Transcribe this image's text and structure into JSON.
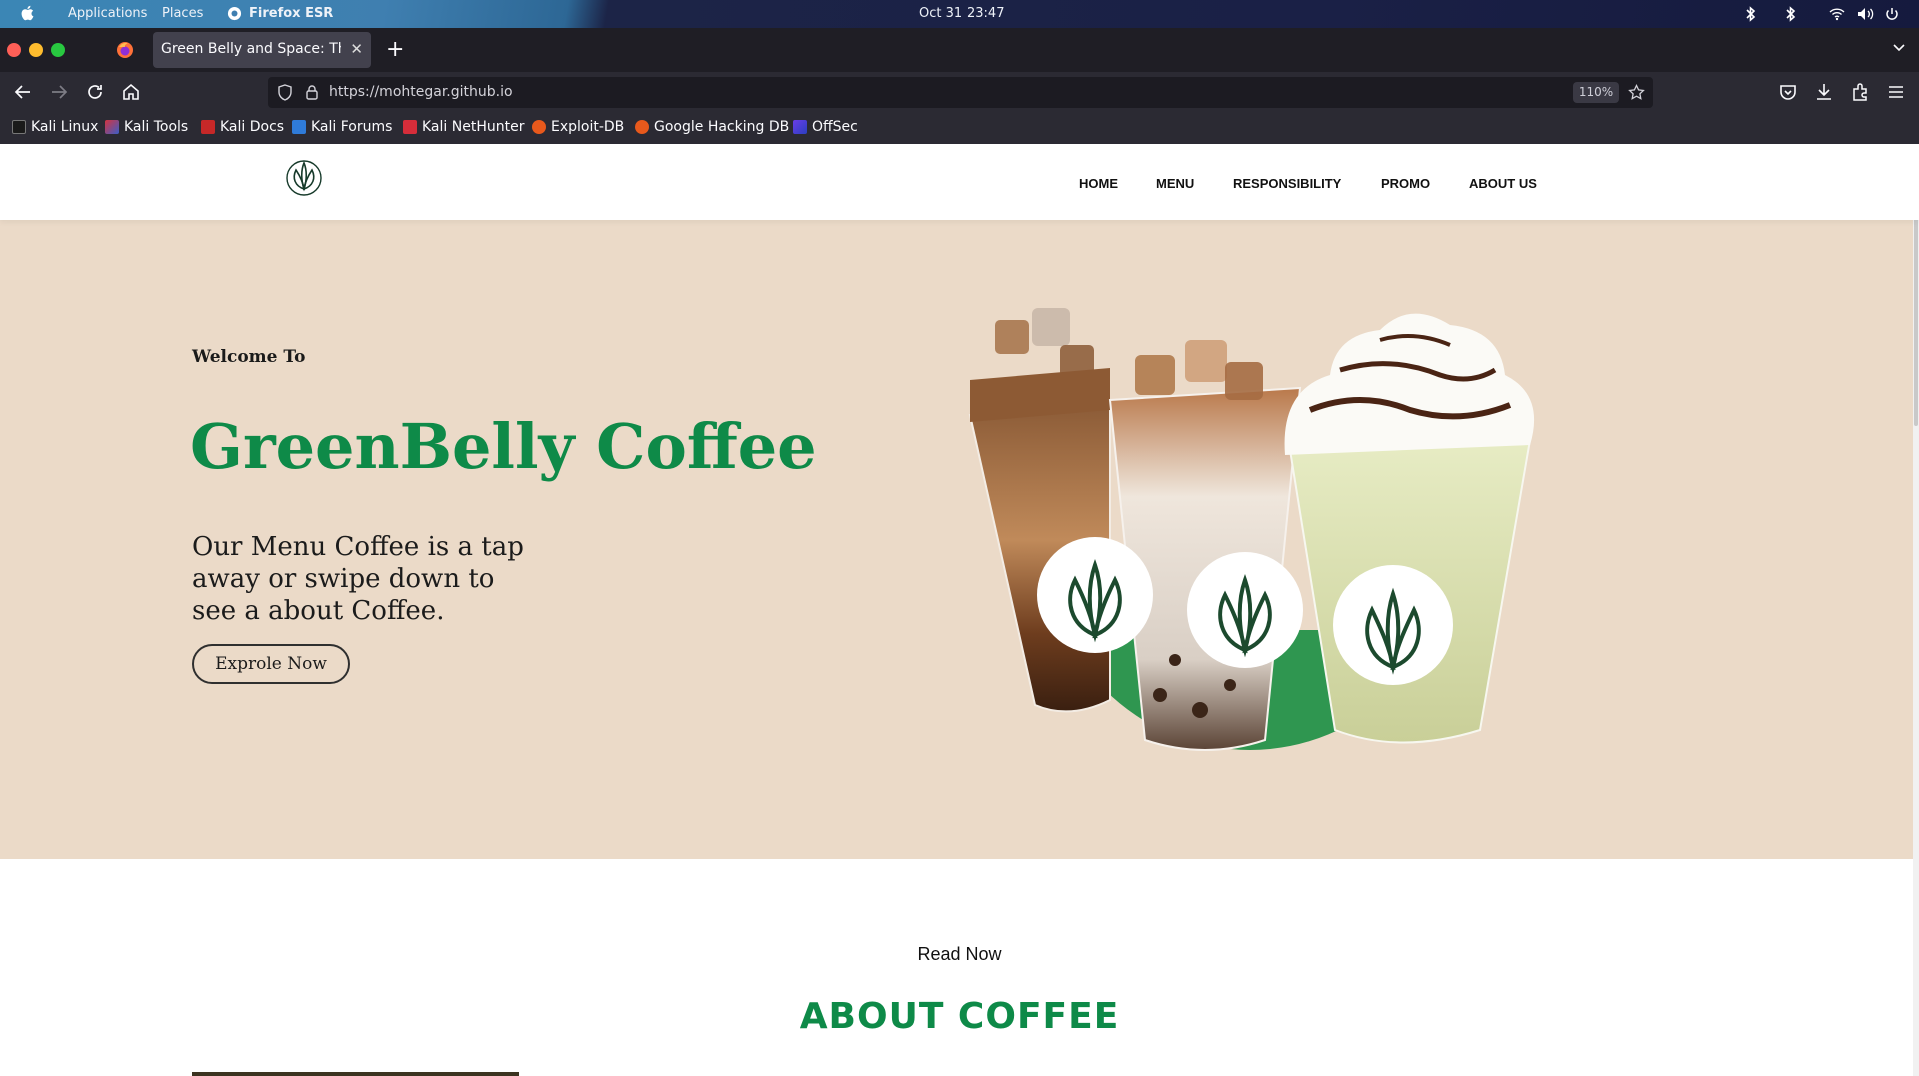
{
  "os_bar": {
    "menus": [
      "Applications",
      "Places"
    ],
    "active_app": "Firefox ESR",
    "date": "Oct 31",
    "time": "23:47"
  },
  "browser": {
    "tab_title": "Green Belly and Space: The B",
    "url": "https://mohtegar.github.io",
    "zoom": "110%",
    "bookmarks": [
      {
        "label": "Kali Linux",
        "icon": "kali-dragon-icon"
      },
      {
        "label": "Kali Tools",
        "icon": "kali-tools-icon"
      },
      {
        "label": "Kali Docs",
        "icon": "kali-docs-icon"
      },
      {
        "label": "Kali Forums",
        "icon": "kali-forums-icon"
      },
      {
        "label": "Kali NetHunter",
        "icon": "nethunter-icon"
      },
      {
        "label": "Exploit-DB",
        "icon": "exploit-db-icon"
      },
      {
        "label": "Google Hacking DB",
        "icon": "ghdb-icon"
      },
      {
        "label": "OffSec",
        "icon": "offsec-icon"
      }
    ]
  },
  "site": {
    "nav": [
      "HOME",
      "MENU",
      "RESPONSIBILITY",
      "PROMO",
      "ABOUT US"
    ],
    "hero": {
      "welcome": "Welcome To",
      "title": "GreenBelly Coffee",
      "subtitle": "Our Menu Coffee is a tap away or swipe down to see a about Coffee.",
      "cta": "Exprole Now"
    },
    "section": {
      "kicker": "Read Now",
      "heading": "ABOUT COFFEE"
    }
  },
  "colors": {
    "brand_green": "#0e8a48",
    "hero_bg": "#ebdac8",
    "circle_green": "#2f9650"
  }
}
